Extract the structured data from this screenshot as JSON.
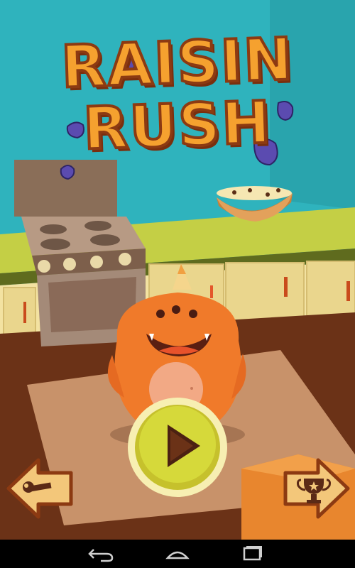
{
  "game": {
    "title_line1": "RAISIN",
    "title_line2": "RUSH"
  },
  "controls": {
    "play": {
      "icon": "play-triangle-icon"
    },
    "settings": {
      "icon": "wrench-icon",
      "direction": "left"
    },
    "leaderboard": {
      "icon": "trophy-icon",
      "direction": "right"
    }
  },
  "android_nav": {
    "back": "back-icon",
    "home": "home-icon",
    "recents": "recents-icon"
  },
  "colors": {
    "sky": "#2fb3bd",
    "counter": "#c4cf45",
    "floor": "#6b3217",
    "rug": "#c8926a",
    "monster": "#f07a2a",
    "title_fill": "#f5a12f",
    "play_button": "#c6c12c",
    "raisin": "#5b4bb0"
  }
}
